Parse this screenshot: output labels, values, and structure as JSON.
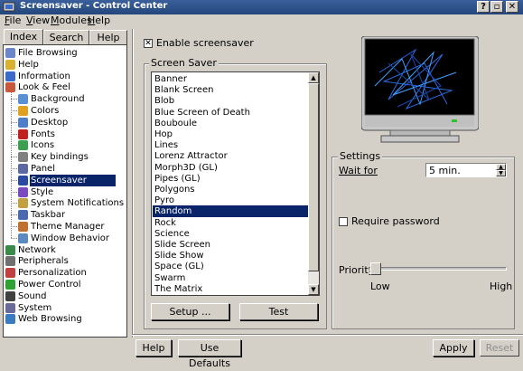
{
  "window": {
    "title": "Screensaver - Control Center"
  },
  "menu": [
    {
      "label": "File",
      "u": "F",
      "rest": "ile"
    },
    {
      "label": "View",
      "u": "V",
      "rest": "iew"
    },
    {
      "label": "Modules",
      "u": "M",
      "rest": "odules"
    },
    {
      "label": "Help",
      "u": "H",
      "rest": "elp"
    }
  ],
  "tabs": [
    "Index",
    "Search",
    "Help"
  ],
  "tree": {
    "items": [
      {
        "label": "File Browsing",
        "icon": "folder-icon",
        "color": "#6b87c9"
      },
      {
        "label": "Help",
        "icon": "help-icon",
        "color": "#d9b030"
      },
      {
        "label": "Information",
        "icon": "info-icon",
        "color": "#3a6bc9"
      },
      {
        "label": "Look & Feel",
        "icon": "brush-icon",
        "color": "#c9573a"
      },
      {
        "label": "Background",
        "icon": "background-icon",
        "color": "#5a8fd4"
      },
      {
        "label": "Colors",
        "icon": "palette-icon",
        "color": "#e0a020"
      },
      {
        "label": "Desktop",
        "icon": "desktop-icon",
        "color": "#4f7fc9"
      },
      {
        "label": "Fonts",
        "icon": "fonts-icon",
        "color": "#c02020"
      },
      {
        "label": "Icons",
        "icon": "icons-icon",
        "color": "#3aa050"
      },
      {
        "label": "Key bindings",
        "icon": "keyboard-icon",
        "color": "#808080"
      },
      {
        "label": "Panel",
        "icon": "panel-icon",
        "color": "#5a6aa0"
      },
      {
        "label": "Screensaver",
        "icon": "screensaver-icon",
        "color": "#2a4aa0"
      },
      {
        "label": "Style",
        "icon": "style-icon",
        "color": "#7a4ac0"
      },
      {
        "label": "System Notifications",
        "icon": "notifications-icon",
        "color": "#c0a040"
      },
      {
        "label": "Taskbar",
        "icon": "taskbar-icon",
        "color": "#4a6ab0"
      },
      {
        "label": "Theme Manager",
        "icon": "theme-icon",
        "color": "#c07030"
      },
      {
        "label": "Window Behavior",
        "icon": "window-icon",
        "color": "#5a8ac0"
      },
      {
        "label": "Network",
        "icon": "network-icon",
        "color": "#3a8a4a"
      },
      {
        "label": "Peripherals",
        "icon": "peripherals-icon",
        "color": "#707070"
      },
      {
        "label": "Personalization",
        "icon": "personalization-icon",
        "color": "#c04040"
      },
      {
        "label": "Power Control",
        "icon": "power-icon",
        "color": "#30a030"
      },
      {
        "label": "Sound",
        "icon": "sound-icon",
        "color": "#404040"
      },
      {
        "label": "System",
        "icon": "system-icon",
        "color": "#6a6a9a"
      },
      {
        "label": "Web Browsing",
        "icon": "globe-icon",
        "color": "#3a7ac0"
      }
    ],
    "selected": "Screensaver"
  },
  "enable": {
    "label": "Enable screensaver",
    "checked": true,
    "mark": "✕"
  },
  "screensaver": {
    "group_label": "Screen Saver",
    "items": [
      "Banner",
      "Blank Screen",
      "Blob",
      "Blue Screen of Death",
      "Bouboule",
      "Hop",
      "Lines",
      "Lorenz Attractor",
      "Morph3D (GL)",
      "Pipes (GL)",
      "Polygons",
      "Pyro",
      "Random",
      "Rock",
      "Science",
      "Slide Screen",
      "Slide Show",
      "Space (GL)",
      "Swarm",
      "The Matrix"
    ],
    "selected": "Random",
    "setup_label": "Setup ...",
    "test_label": "Test"
  },
  "settings": {
    "group_label": "Settings",
    "wait_label": "Wait for",
    "wait_value": "5 min.",
    "require_password_label": "Require password",
    "require_password_checked": false,
    "priority_label": "Priority",
    "priority_low": "Low",
    "priority_high": "High",
    "priority_level": 0.0
  },
  "footer": {
    "help_label": "Help",
    "defaults_label": "Use Defaults",
    "apply_label": "Apply",
    "reset_label": "Reset"
  }
}
